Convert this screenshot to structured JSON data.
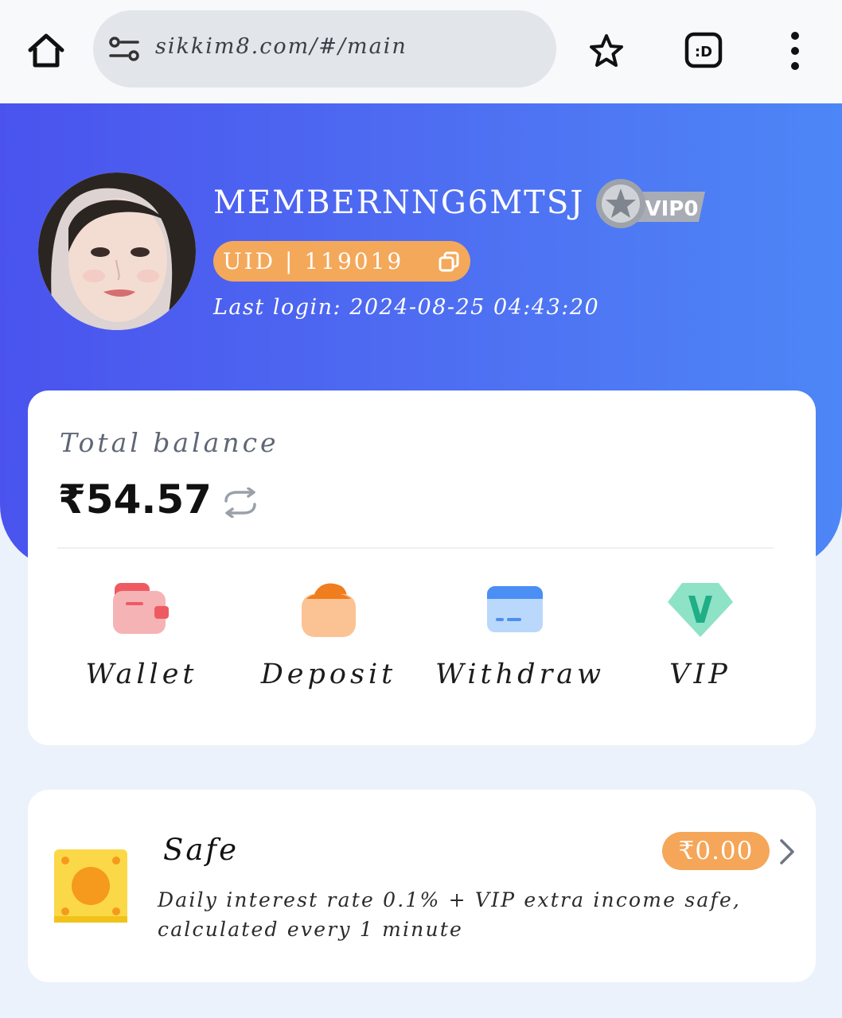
{
  "browser": {
    "url": "sikkim8.com/#/main",
    "tab_label": ":D"
  },
  "profile": {
    "username": "MEMBERNNG6MTSJ",
    "vip_badge": "VIP0",
    "uid_label": "UID | 119019",
    "last_login": "Last login: 2024-08-25 04:43:20"
  },
  "balance": {
    "label": "Total balance",
    "value": "₹54.57"
  },
  "actions": [
    {
      "label": "Wallet",
      "icon": "wallet-icon"
    },
    {
      "label": "Deposit",
      "icon": "deposit-icon"
    },
    {
      "label": "Withdraw",
      "icon": "withdraw-icon"
    },
    {
      "label": "VIP",
      "icon": "vip-icon"
    }
  ],
  "safe": {
    "title": "Safe",
    "amount": "₹0.00",
    "description": "Daily interest rate 0.1% + VIP extra income safe, calculated every 1 minute"
  },
  "colors": {
    "hero_start": "#4a53ee",
    "hero_end": "#4d86f6",
    "accent_orange": "#f4a85a",
    "page_bg": "#ecf2fb"
  }
}
